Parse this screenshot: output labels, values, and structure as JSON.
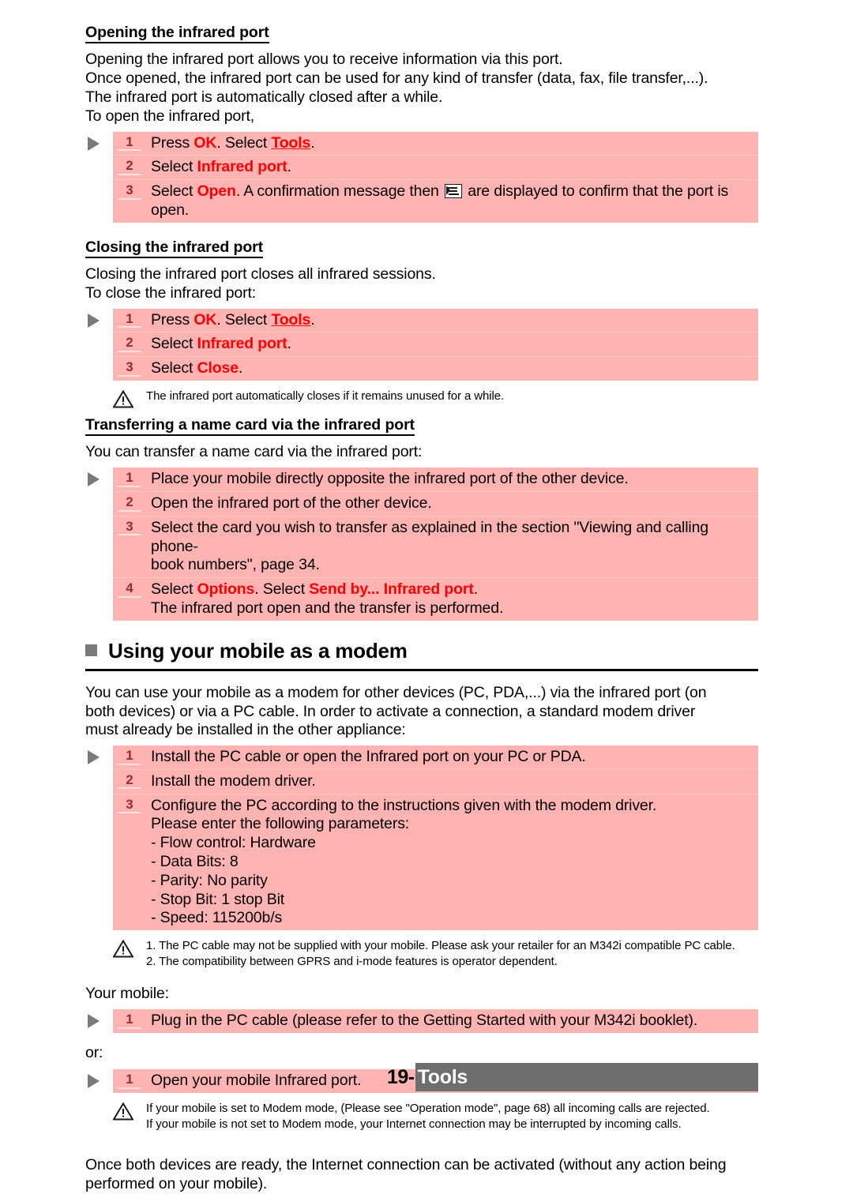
{
  "document": {
    "sections": [
      {
        "heading": "Opening the infrared port",
        "paragraphs": [
          "Opening the infrared port allows you to receive information via this port.",
          "Once opened, the infrared port can be used for any kind of transfer (data, fax, file transfer,...).",
          "The infrared port is automatically closed after a while.",
          "To open the infrared port,"
        ]
      },
      {
        "heading": "Closing the infrared port",
        "paragraphs": [
          "Closing the infrared port closes all infrared sessions.",
          "To close the infrared port:"
        ]
      },
      {
        "heading": "Transferring a name card via the infrared port",
        "paragraphs": [
          "You can transfer a name card via the infrared port:"
        ]
      }
    ],
    "main_heading": "Using your mobile as a modem",
    "modem_intro": [
      "You can use your mobile as a modem for other devices (PC, PDA,...) via the infrared port (on",
      "both devices) or via a PC cable. In order to activate a connection, a standard modem driver",
      "must already be installed in the other appliance:"
    ],
    "your_mobile_label": "Your mobile:",
    "or_label": "or:",
    "closing_paragraph": [
      "Once both devices are ready, the Internet connection can be activated (without any action being",
      "performed on your mobile)."
    ]
  },
  "steps_open": [
    {
      "num": "1",
      "lines": [
        [
          {
            "t": "Press ",
            "s": "plain"
          },
          {
            "t": "OK",
            "s": "red"
          },
          {
            "t": ". Select ",
            "s": "plain"
          },
          {
            "t": "Tools",
            "s": "red-underline"
          },
          {
            "t": ".",
            "s": "plain"
          }
        ]
      ]
    },
    {
      "num": "2",
      "lines": [
        [
          {
            "t": "Select ",
            "s": "plain"
          },
          {
            "t": "Infrared port",
            "s": "red"
          },
          {
            "t": ".",
            "s": "plain"
          }
        ]
      ]
    },
    {
      "num": "3",
      "lines": [
        [
          {
            "t": "Select ",
            "s": "plain"
          },
          {
            "t": "Open",
            "s": "red"
          },
          {
            "t": ". A confirmation message then ",
            "s": "plain"
          },
          {
            "t": "",
            "s": "ir-icon"
          },
          {
            "t": " are displayed to confirm that the port is open.",
            "s": "plain"
          }
        ]
      ]
    }
  ],
  "steps_close": [
    {
      "num": "1",
      "lines": [
        [
          {
            "t": "Press ",
            "s": "plain"
          },
          {
            "t": "OK",
            "s": "red"
          },
          {
            "t": ". Select ",
            "s": "plain"
          },
          {
            "t": "Tools",
            "s": "red-underline"
          },
          {
            "t": ".",
            "s": "plain"
          }
        ]
      ]
    },
    {
      "num": "2",
      "lines": [
        [
          {
            "t": "Select ",
            "s": "plain"
          },
          {
            "t": "Infrared port",
            "s": "red"
          },
          {
            "t": ".",
            "s": "plain"
          }
        ]
      ]
    },
    {
      "num": "3",
      "lines": [
        [
          {
            "t": "Select ",
            "s": "plain"
          },
          {
            "t": "Close",
            "s": "red"
          },
          {
            "t": ".",
            "s": "plain"
          }
        ]
      ]
    }
  ],
  "steps_namecard": [
    {
      "num": "1",
      "lines": [
        [
          {
            "t": "Place your mobile directly opposite the infrared port of the other device.",
            "s": "plain"
          }
        ]
      ]
    },
    {
      "num": "2",
      "lines": [
        [
          {
            "t": "Open the infrared port of the other device.",
            "s": "plain"
          }
        ]
      ]
    },
    {
      "num": "3",
      "lines": [
        [
          {
            "t": "Select the card you wish to transfer as explained in the section \"Viewing and calling phone-",
            "s": "plain"
          }
        ],
        [
          {
            "t": "book numbers\", page 34.",
            "s": "plain"
          }
        ]
      ]
    },
    {
      "num": "4",
      "lines": [
        [
          {
            "t": "Select ",
            "s": "plain"
          },
          {
            "t": "Options",
            "s": "red"
          },
          {
            "t": ". Select ",
            "s": "plain"
          },
          {
            "t": "Send by... Infrared port",
            "s": "red"
          },
          {
            "t": ".",
            "s": "plain"
          }
        ],
        [
          {
            "t": "The infrared port open and the transfer is performed.",
            "s": "plain"
          }
        ]
      ]
    }
  ],
  "steps_modem": [
    {
      "num": "1",
      "lines": [
        [
          {
            "t": "Install the PC cable or open the Infrared port on your PC or PDA.",
            "s": "plain"
          }
        ]
      ]
    },
    {
      "num": "2",
      "lines": [
        [
          {
            "t": "Install the modem driver.",
            "s": "plain"
          }
        ]
      ]
    },
    {
      "num": "3",
      "lines": [
        [
          {
            "t": "Configure the PC according to the instructions given with the modem driver.",
            "s": "plain"
          }
        ],
        [
          {
            "t": "Please enter the following parameters:",
            "s": "plain"
          }
        ],
        [
          {
            "t": "- Flow control: Hardware",
            "s": "plain"
          }
        ],
        [
          {
            "t": "- Data Bits: 8",
            "s": "plain"
          }
        ],
        [
          {
            "t": "- Parity: No parity",
            "s": "plain"
          }
        ],
        [
          {
            "t": "- Stop Bit: 1 stop Bit",
            "s": "plain"
          }
        ],
        [
          {
            "t": "- Speed: 115200b/s",
            "s": "plain"
          }
        ]
      ]
    }
  ],
  "steps_pccable": [
    {
      "num": "1",
      "lines": [
        [
          {
            "t": "Plug in the PC cable (please refer to the Getting Started with your M342i booklet).",
            "s": "plain"
          }
        ]
      ]
    }
  ],
  "steps_irport": [
    {
      "num": "1",
      "lines": [
        [
          {
            "t": "Open your mobile Infrared port.",
            "s": "plain"
          }
        ]
      ]
    }
  ],
  "notes": {
    "note_close": [
      "The infrared port automatically closes if it remains unused for a while."
    ],
    "note_modem": [
      "1. The PC cable may not be supplied with your mobile. Please ask your retailer for an M342i compatible PC cable.",
      "2. The compatibility between GPRS and i-mode features is operator dependent."
    ],
    "note_modemmode": [
      "If your mobile is set to Modem mode, (Please see \"Operation mode\", page 68) all incoming calls are rejected.",
      "If your mobile is not set to Modem mode, your Internet connection may be interrupted by incoming calls."
    ]
  },
  "footer": {
    "page_number": "19-",
    "chapter": "Tools"
  },
  "colors": {
    "step_background": "#ffb3b3",
    "step_number": "#9b2c2c",
    "accent_red": "#ff0000",
    "footer_bar": "#6e6e6e",
    "bullet_gray": "#7a7a7a"
  }
}
